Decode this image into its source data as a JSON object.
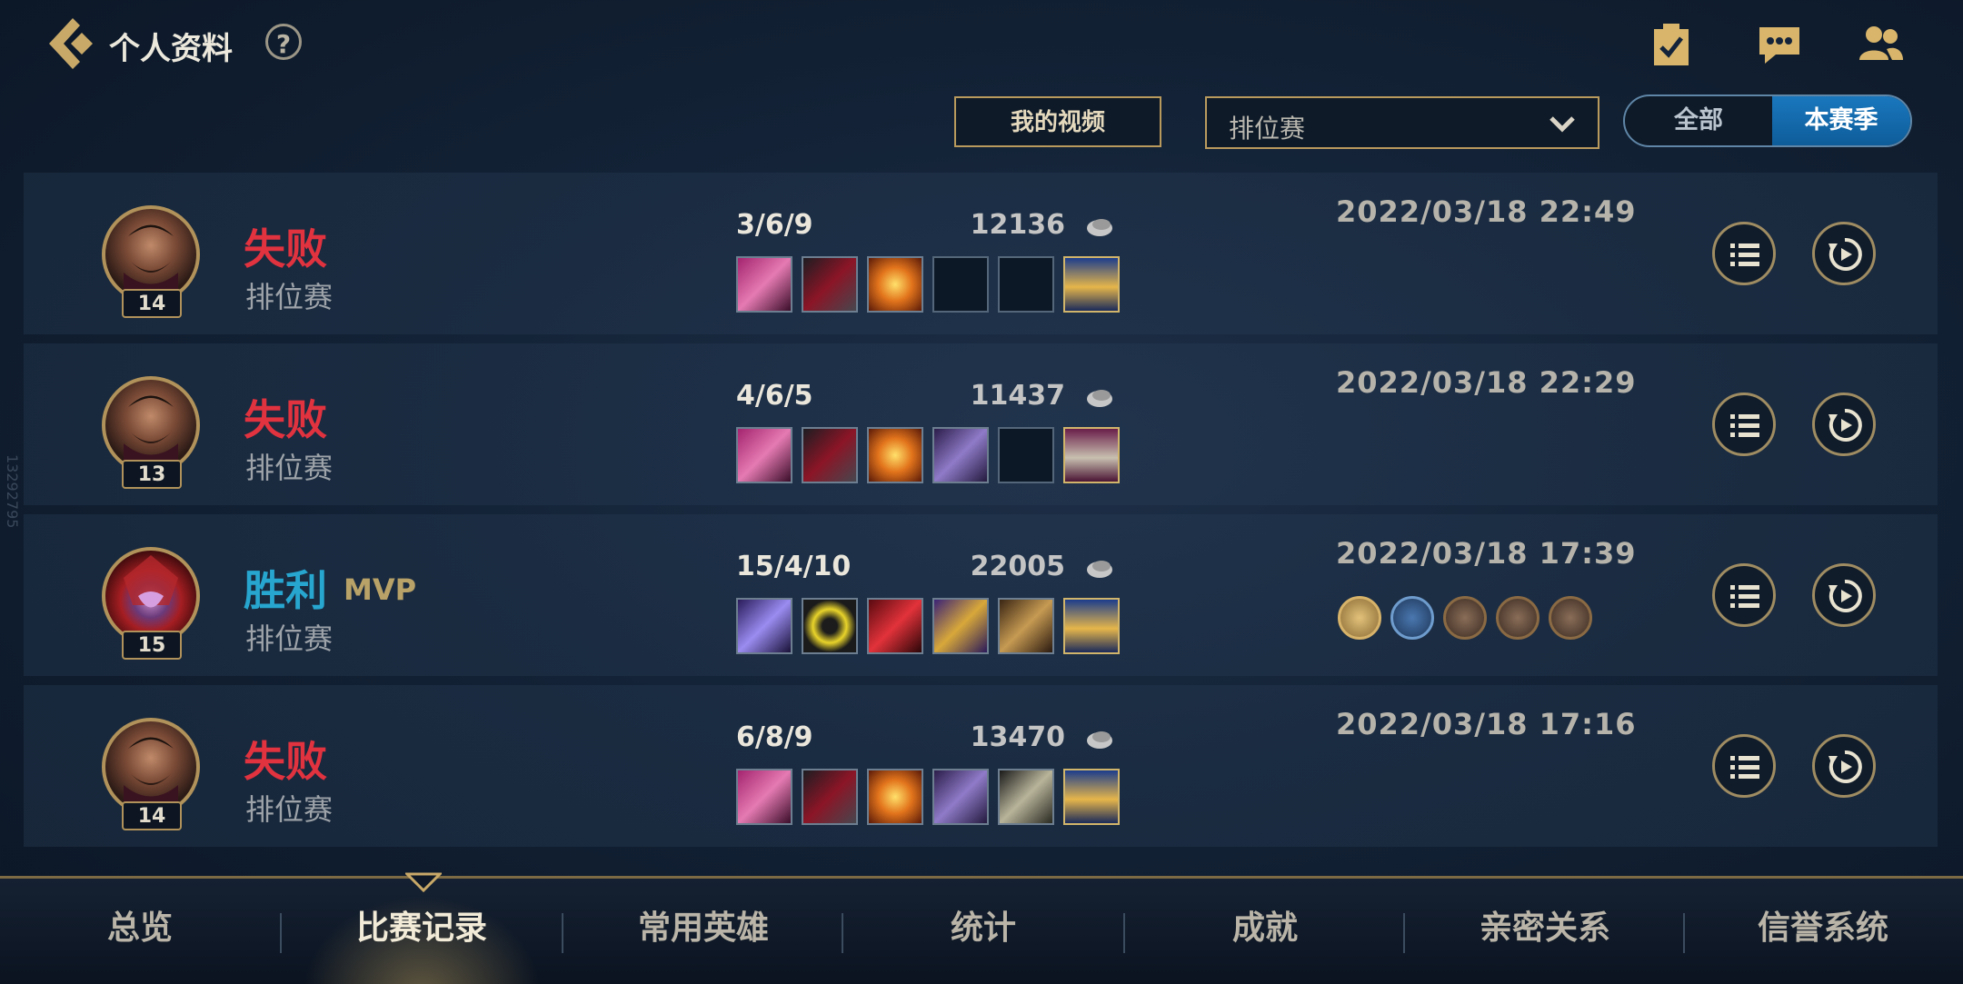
{
  "header": {
    "title": "个人资料",
    "help_label": "?"
  },
  "filters": {
    "my_video_label": "我的视频",
    "mode_selected": "排位赛",
    "season_all_label": "全部",
    "season_current_label": "本赛季"
  },
  "matches": [
    {
      "result": "失败",
      "queue": "排位赛",
      "level": "14",
      "kda": "3/6/9",
      "gold": "12136",
      "datetime": "2022/03/18 22:49",
      "mvp": ""
    },
    {
      "result": "失败",
      "queue": "排位赛",
      "level": "13",
      "kda": "4/6/5",
      "gold": "11437",
      "datetime": "2022/03/18 22:29",
      "mvp": ""
    },
    {
      "result": "胜利",
      "queue": "排位赛",
      "level": "15",
      "kda": "15/4/10",
      "gold": "22005",
      "datetime": "2022/03/18 17:39",
      "mvp": "MVP"
    },
    {
      "result": "失败",
      "queue": "排位赛",
      "level": "14",
      "kda": "6/8/9",
      "gold": "13470",
      "datetime": "2022/03/18 17:16",
      "mvp": ""
    }
  ],
  "tabs": [
    {
      "label": "总览"
    },
    {
      "label": "比赛记录",
      "active": true
    },
    {
      "label": "常用英雄"
    },
    {
      "label": "统计"
    },
    {
      "label": "成就"
    },
    {
      "label": "亲密关系"
    },
    {
      "label": "信誉系统"
    }
  ],
  "watermark": "13292795",
  "colors": {
    "lose": "#e0323f",
    "win": "#27a6cf",
    "gold_accent": "#b99a5d",
    "active_tab_blue": "#1a77bd"
  },
  "icons": {
    "back": "back-chevron-icon",
    "tasks": "clipboard-check-icon",
    "chat": "chat-bubble-icon",
    "friends": "friends-icon",
    "gold": "gold-coin-icon",
    "detail": "list-icon",
    "replay": "replay-icon"
  }
}
